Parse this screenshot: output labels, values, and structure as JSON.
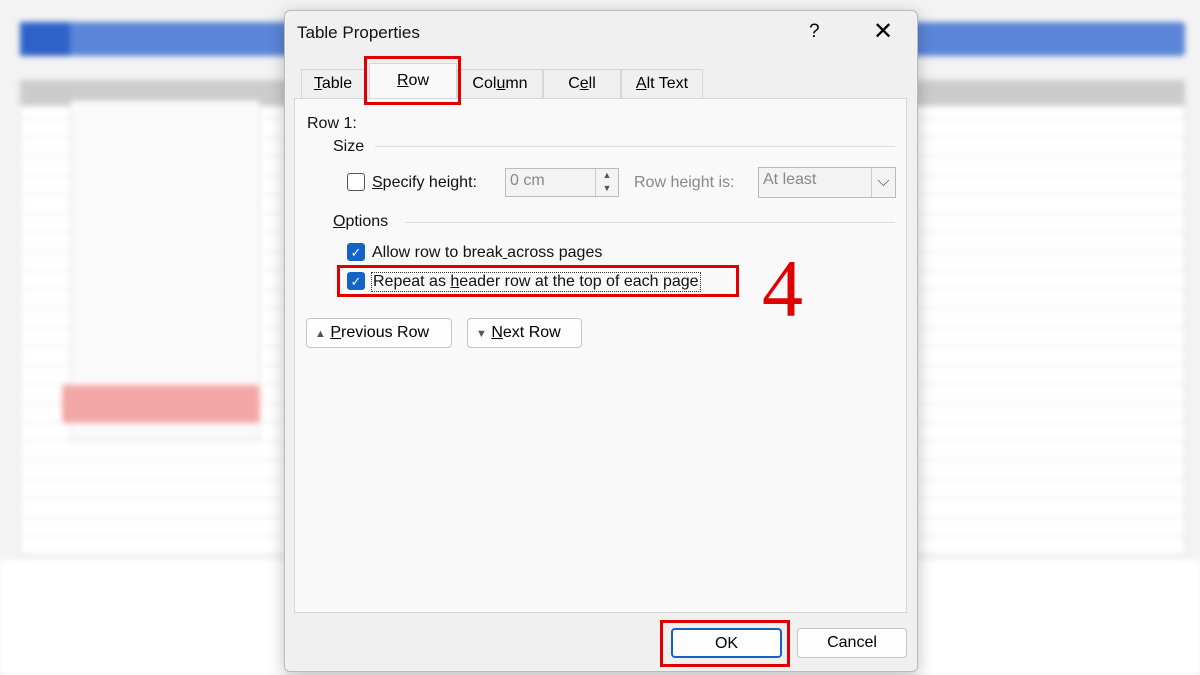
{
  "dialog": {
    "title": "Table Properties",
    "help": "?",
    "close": "✕"
  },
  "tabs": [
    {
      "label": "Table",
      "accel": 0
    },
    {
      "label": "Row",
      "accel": 0
    },
    {
      "label": "Column",
      "accel": 3
    },
    {
      "label": "Cell",
      "accel": 1
    },
    {
      "label": "Alt Text",
      "accel": 0
    }
  ],
  "active_tab": "Row",
  "row": {
    "heading": "Row 1:",
    "size": {
      "label": "Size",
      "specify_height": {
        "label": "Specify height:",
        "accel": 0,
        "checked": false
      },
      "height_value": "0 cm",
      "row_height_is": "Row height is:",
      "row_height_select": "At least"
    },
    "options": {
      "label": "Options",
      "accel": 0,
      "allow_break": {
        "label": "Allow row to break across pages",
        "accel": 18,
        "checked": true
      },
      "repeat_header": {
        "label": "Repeat as header row at the top of each page",
        "accel": 10,
        "checked": true
      }
    },
    "previous_row": {
      "label": "Previous Row",
      "accel": 0
    },
    "next_row": {
      "label": "Next Row",
      "accel": 0
    }
  },
  "footer": {
    "ok": "OK",
    "cancel": "Cancel"
  },
  "annotation": {
    "step": "4",
    "highlight_color": "#e00000"
  },
  "colors": {
    "checkbox": "#1464c8"
  }
}
